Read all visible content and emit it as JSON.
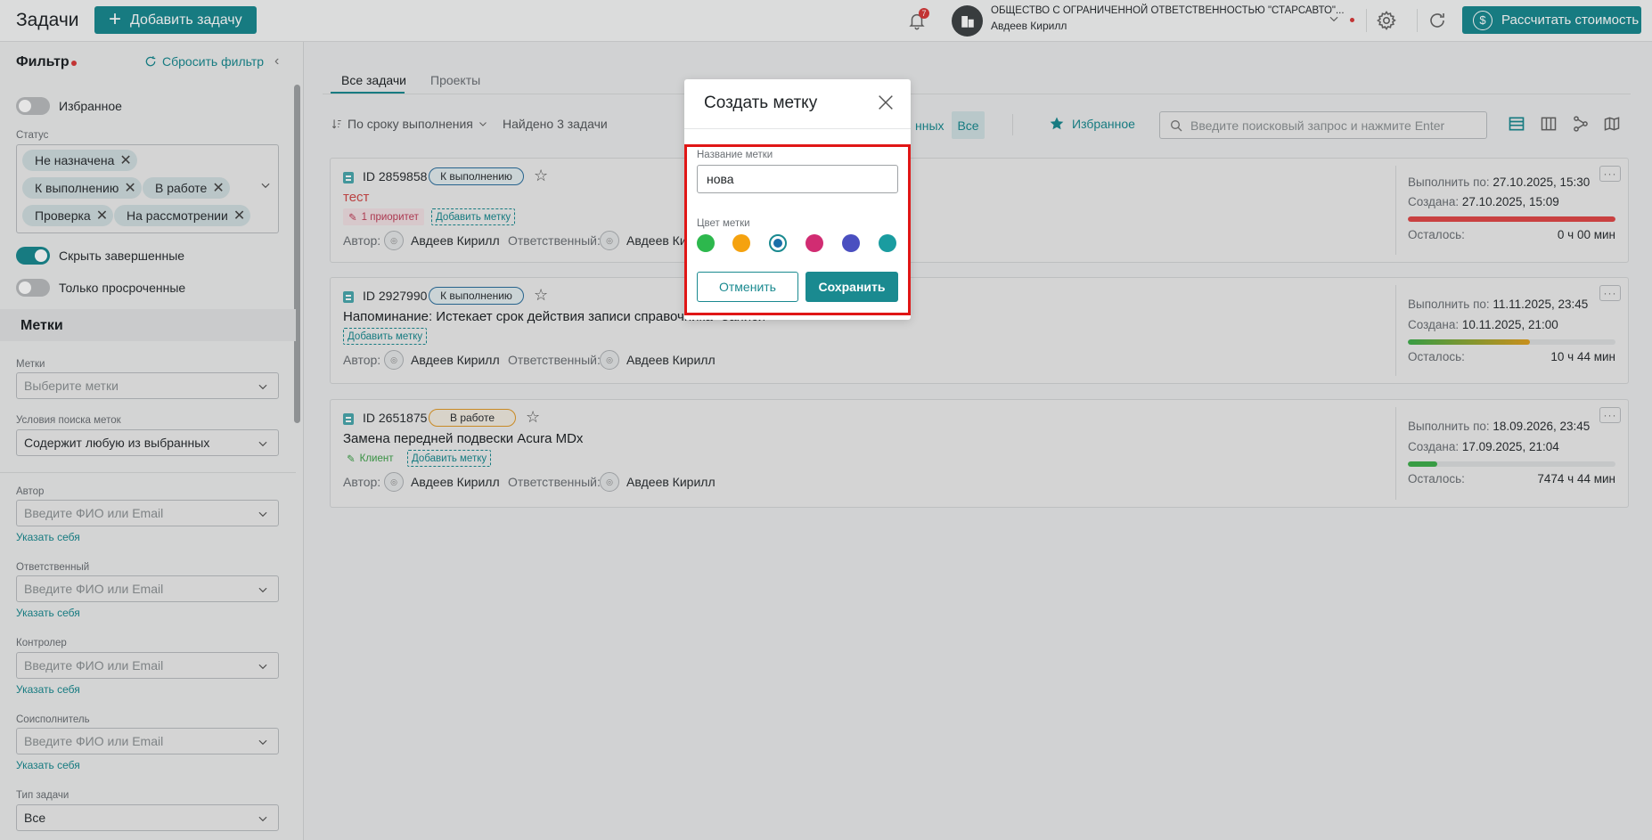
{
  "header": {
    "title": "Задачи",
    "add_task_label": "Добавить задачу",
    "notifications_count": "7",
    "org_name": "ОБЩЕСТВО С ОГРАНИЧЕННОЙ ОТВЕТСТВЕННОСТЬЮ \"СТАРСАВТО\"...",
    "user_name": "Авдеев Кирилл",
    "calc_label": "Рассчитать стоимость"
  },
  "sidebar": {
    "filter_title": "Фильтр",
    "reset_label": "Сбросить фильтр",
    "favorites_label": "Избранное",
    "status_label": "Статус",
    "status_chips": [
      "Не назначена",
      "К выполнению",
      "В работе",
      "Проверка",
      "На рассмотрении"
    ],
    "hide_done_label": "Скрыть завершенные",
    "overdue_label": "Только просроченные",
    "tags_section": "Метки",
    "tags_label": "Метки",
    "tags_placeholder": "Выберите метки",
    "tag_cond_label": "Условия поиска меток",
    "tag_cond_value": "Содержит любую из выбранных",
    "author_label": "Автор",
    "responsible_label": "Ответственный",
    "controller_label": "Контролер",
    "coexec_label": "Соисполнитель",
    "person_placeholder": "Введите ФИО или Email",
    "set_self": "Указать себя",
    "task_type_label": "Тип задачи",
    "task_type_value": "Все"
  },
  "main": {
    "tab_all": "Все задачи",
    "tab_projects": "Проекты",
    "sort_label": "По сроку выполнения",
    "found_label": "Найдено 3 задачи",
    "seg_partial": "нных",
    "seg_all": "Все",
    "favorites_btn": "Избранное",
    "search_placeholder": "Введите поисковый запрос и нажмите Enter",
    "author_prefix": "Автор:",
    "responsible_prefix": "Ответственный:",
    "add_tag_label": "Добавить метку",
    "due_prefix": "Выполнить по:",
    "created_prefix": "Создана:",
    "left_prefix": "Осталось:"
  },
  "tasks": [
    {
      "id": "ID 2859858",
      "status": "К выполнению",
      "title": "тест",
      "tag": "1 приоритет",
      "author": "Авдеев Кирилл",
      "responsible": "Авдеев Ки",
      "due": "27.10.2025, 15:30",
      "created": "27.10.2025, 15:09",
      "left": "0 ч 00 мин",
      "progress": 1.0
    },
    {
      "id": "ID 2927990",
      "status": "К выполнению",
      "title": "Напоминание: Истекает срок действия записи справочника \"Записи\"",
      "author": "Авдеев Кирилл",
      "responsible": "Авдеев Кирилл",
      "due": "11.11.2025, 23:45",
      "created": "10.11.2025, 21:00",
      "left": "10 ч 44 мин",
      "progress": 0.59
    },
    {
      "id": "ID 2651875",
      "status": "В работе",
      "title": "Замена передней подвески Acura MDx",
      "tag": "Клиент",
      "author": "Авдеев Кирилл",
      "responsible": "Авдеев Кирилл",
      "due": "18.09.2026, 23:45",
      "created": "17.09.2025, 21:04",
      "left": "7474 ч 44 мин",
      "progress": 0.14
    }
  ],
  "modal": {
    "title": "Создать метку",
    "name_label": "Название метки",
    "name_value": "нова",
    "color_label": "Цвет метки",
    "colors": [
      "#2db84d",
      "#f5a20f",
      "#1a6fa8",
      "#d12c72",
      "#4a4fc0",
      "#1a9ca0"
    ],
    "selected_color_index": 2,
    "cancel_label": "Отменить",
    "save_label": "Сохранить",
    "highlight_color": "#e01616"
  }
}
